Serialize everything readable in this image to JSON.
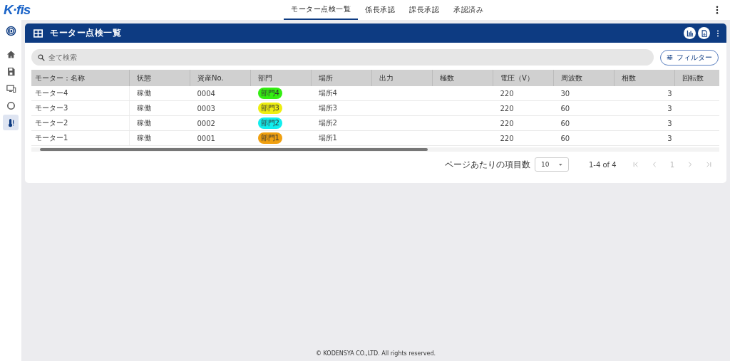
{
  "app": {
    "logo": "K·fis"
  },
  "nav_tabs": [
    {
      "label": "モーター点検一覧",
      "selected": true
    },
    {
      "label": "係長承認",
      "selected": false
    },
    {
      "label": "課長承認",
      "selected": false
    },
    {
      "label": "承認済み",
      "selected": false
    }
  ],
  "sidebar": {
    "items": [
      {
        "selected": false
      },
      {
        "selected": false
      },
      {
        "selected": false
      },
      {
        "selected": false
      },
      {
        "selected": true
      }
    ]
  },
  "panel": {
    "title": "モーター点検一覧"
  },
  "search": {
    "placeholder": "全て検索"
  },
  "filter_button": "フィルター",
  "table": {
    "columns": [
      "モーター：名称",
      "状態",
      "資産No.",
      "部門",
      "場所",
      "出力",
      "極数",
      "電圧（V）",
      "周波数",
      "相数",
      "回転数"
    ],
    "rows": [
      {
        "cells": [
          "モーター4",
          "稼働",
          "0004",
          "部門4",
          "場所4",
          "",
          "",
          "220",
          "30",
          "3",
          ""
        ],
        "color": "#33ee11"
      },
      {
        "cells": [
          "モーター3",
          "稼働",
          "0003",
          "部門3",
          "場所3",
          "",
          "",
          "220",
          "60",
          "3",
          ""
        ],
        "color": "#eeee11"
      },
      {
        "cells": [
          "モーター2",
          "稼働",
          "0002",
          "部門2",
          "場所2",
          "",
          "",
          "220",
          "60",
          "3",
          ""
        ],
        "color": "#11eeee"
      },
      {
        "cells": [
          "モーター1",
          "稼働",
          "0001",
          "部門1",
          "場所1",
          "",
          "",
          "220",
          "60",
          "3",
          ""
        ],
        "color": "#f0a010"
      }
    ]
  },
  "pagination": {
    "per_page_label": "ページあたりの項目数",
    "per_page": "10",
    "range": "1-4 of 4",
    "page": "1"
  },
  "footer": "© KODENSYA CO.,LTD. All rights reserved."
}
